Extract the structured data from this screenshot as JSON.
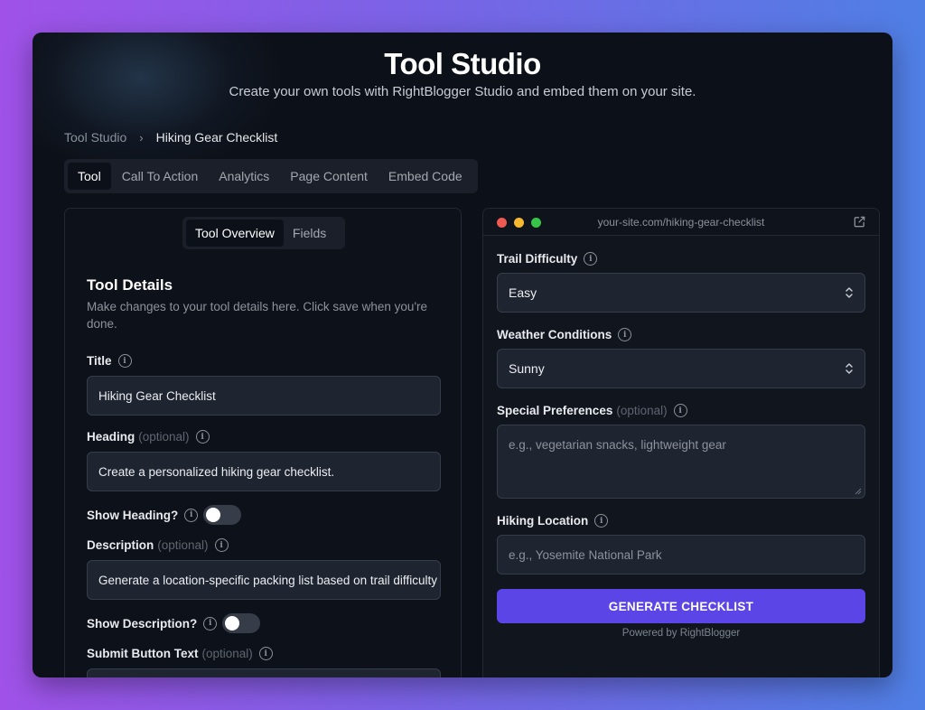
{
  "header": {
    "title": "Tool Studio",
    "subtitle": "Create your own tools with RightBlogger Studio and embed them on your site."
  },
  "breadcrumb": {
    "root": "Tool Studio",
    "separator": "›",
    "current": "Hiking Gear Checklist"
  },
  "tabs": [
    {
      "label": "Tool",
      "active": true
    },
    {
      "label": "Call To Action",
      "active": false
    },
    {
      "label": "Analytics",
      "active": false
    },
    {
      "label": "Page Content",
      "active": false
    },
    {
      "label": "Embed Code",
      "active": false
    }
  ],
  "editor": {
    "subtabs": [
      {
        "label": "Tool Overview",
        "active": true
      },
      {
        "label": "Fields",
        "active": false
      }
    ],
    "section_title": "Tool Details",
    "section_desc": "Make changes to your tool details here. Click save when you're done.",
    "optional_text": "(optional)",
    "title_label": "Title",
    "title_value": "Hiking Gear Checklist",
    "heading_label": "Heading",
    "heading_value": "Create a personalized hiking gear checklist.",
    "show_heading_label": "Show Heading?",
    "show_heading": false,
    "description_label": "Description",
    "description_value": "Generate a location-specific packing list based on trail difficulty",
    "show_description_label": "Show Description?",
    "show_description": false,
    "submit_label": "Submit Button Text"
  },
  "preview": {
    "url": "your-site.com/hiking-gear-checklist",
    "trail_label": "Trail Difficulty",
    "trail_value": "Easy",
    "weather_label": "Weather Conditions",
    "weather_value": "Sunny",
    "prefs_label": "Special Preferences",
    "prefs_optional": "(optional)",
    "prefs_placeholder": "e.g., vegetarian snacks, lightweight gear",
    "location_label": "Hiking Location",
    "location_placeholder": "e.g., Yosemite National Park",
    "button_label": "GENERATE CHECKLIST",
    "powered_by": "Powered by RightBlogger"
  },
  "colors": {
    "accent": "#5b45e6",
    "panel": "#0c1018",
    "input": "#1e2430"
  }
}
